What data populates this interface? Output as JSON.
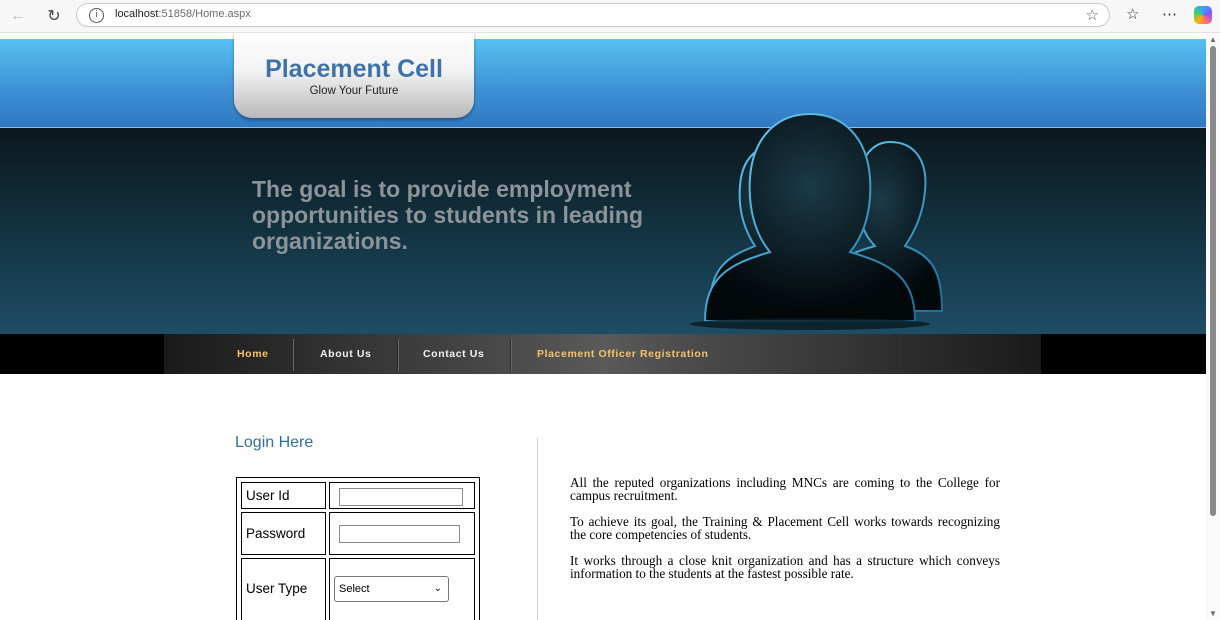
{
  "browser": {
    "url_host": "localhost",
    "url_rest": ":51858/Home.aspx",
    "icons": [
      "back-arrow-icon",
      "reload-icon",
      "site-info-icon",
      "favorite-star-icon",
      "favorites-icon",
      "more-icon",
      "copilot-icon"
    ]
  },
  "header": {
    "title": "Placement Cell",
    "subtitle": "Glow Your Future"
  },
  "banner": {
    "tagline": "The goal is to provide employment opportunities to students in leading organizations."
  },
  "menu": {
    "items": [
      {
        "label": "Home"
      },
      {
        "label": "About Us"
      },
      {
        "label": "Contact Us"
      },
      {
        "label": "Placement Officer Registration"
      }
    ]
  },
  "login": {
    "title": "Login Here",
    "user_id_label": "User Id",
    "password_label": "Password",
    "user_type_label": "User Type",
    "user_type_selected": "Select"
  },
  "info": {
    "paragraphs": [
      "All the reputed organizations including MNCs are coming to the College for campus recruitment.",
      "To achieve its goal, the Training & Placement Cell works towards recognizing the core competencies of students.",
      "It works through a close knit organization and has a structure which conveys information to the students at the fastest possible rate."
    ]
  },
  "colors": {
    "header_blue": "#4aa6e3",
    "title_blue": "#3f73a8",
    "menu_highlight": "#f5c46a",
    "login_title": "#2f6ea3"
  }
}
